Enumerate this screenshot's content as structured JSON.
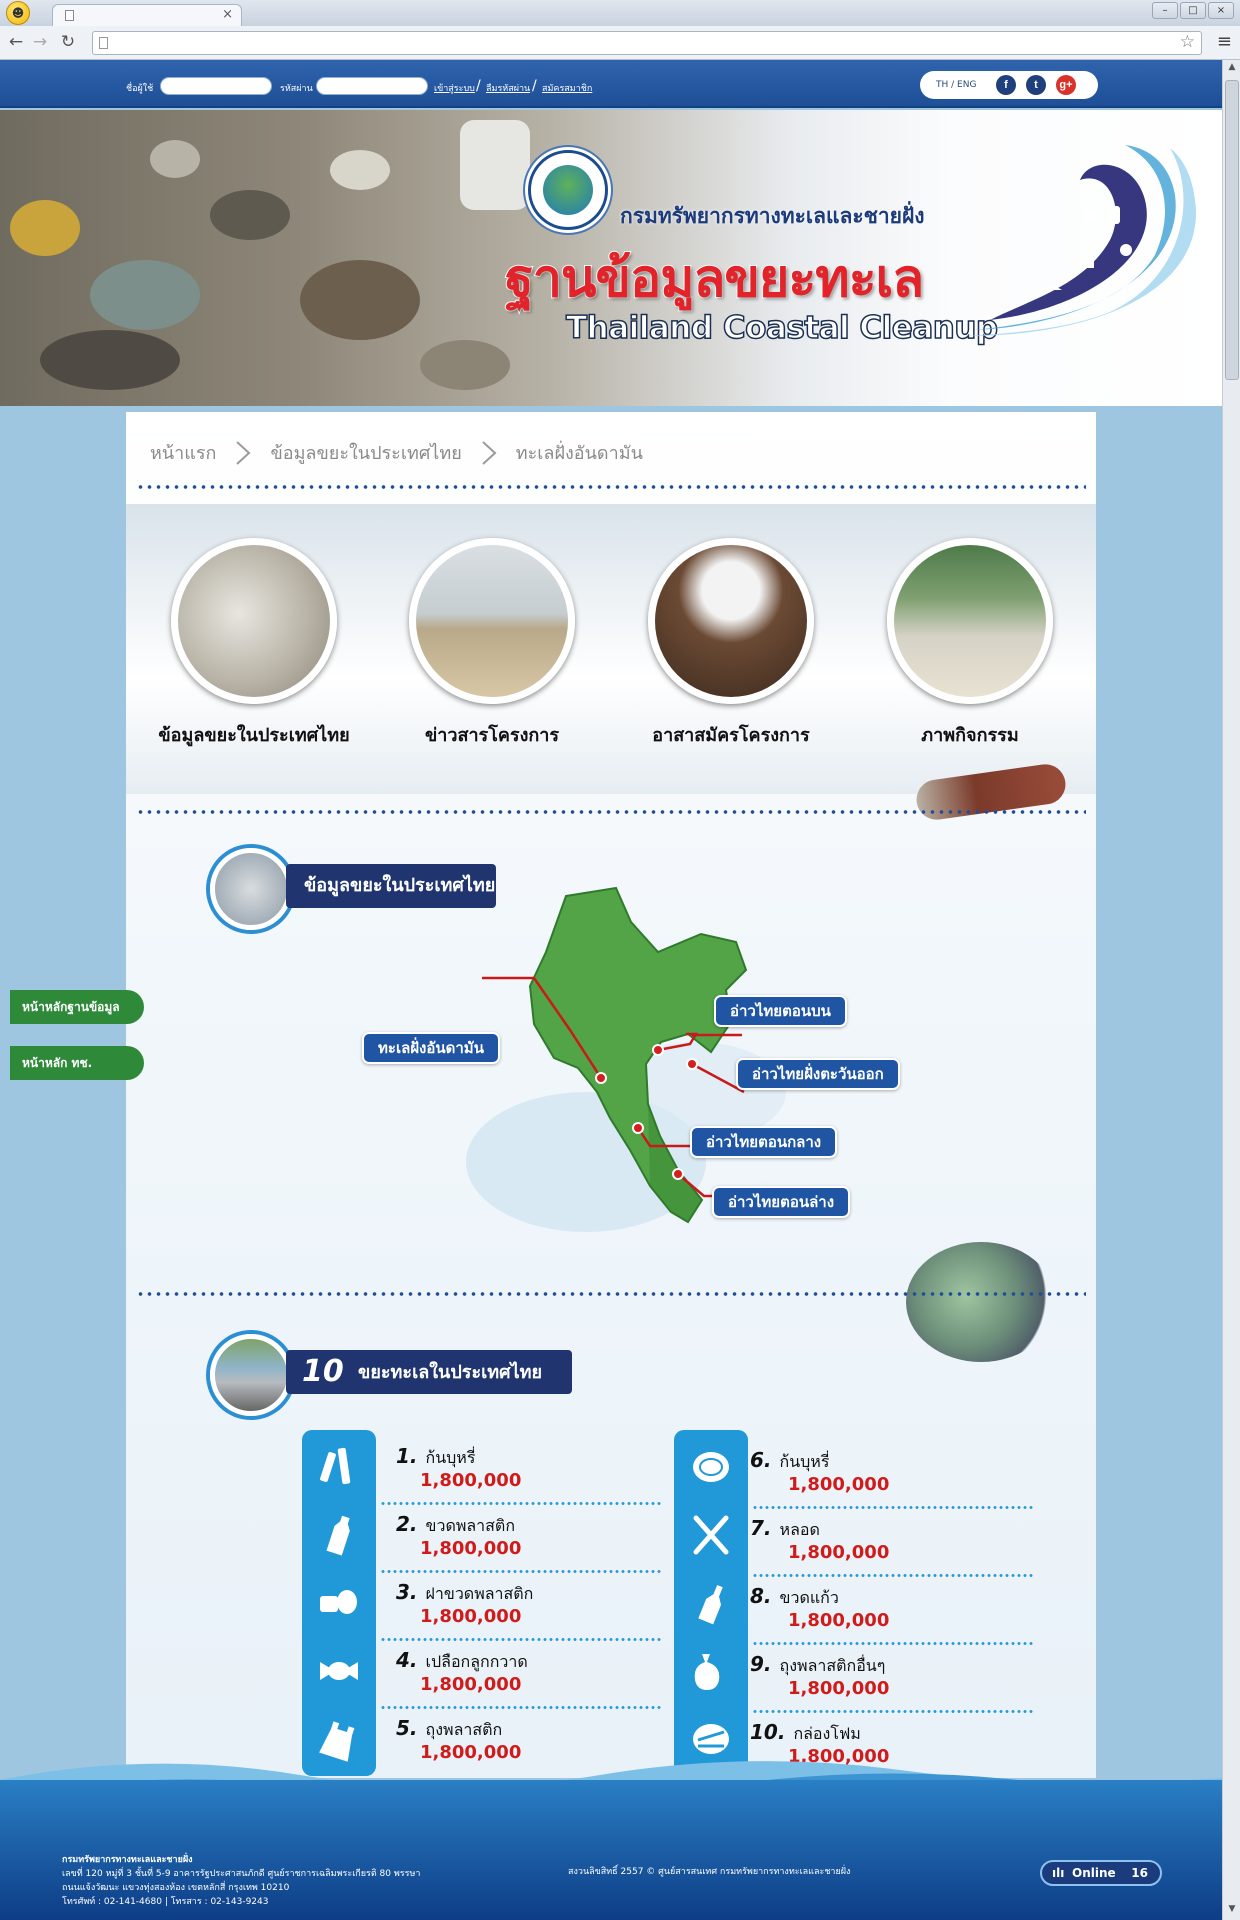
{
  "browser": {
    "tab_title": "",
    "url": "",
    "window_controls": [
      "–",
      "□",
      "×"
    ]
  },
  "topbar": {
    "username_label": "ชื่อผู้ใช้",
    "password_label": "รหัสผ่าน",
    "login_link": "เข้าสู่ระบบ",
    "forgot_link": "ลืมรหัสผ่าน",
    "register_link": "สมัครสมาชิก",
    "lang": "TH / ENG",
    "social_icons": [
      "facebook-icon",
      "twitter-icon",
      "google-plus-icon"
    ]
  },
  "banner": {
    "agency": "กรมทรัพยากรทางทะเลและชายฝั่ง",
    "title_th": "ฐานข้อมูลขยะทะเล",
    "title_en": "Thailand Coastal Cleanup"
  },
  "breadcrumb": [
    "หน้าแรก",
    "ข้อมูลขยะในประเทศไทย",
    "ทะเลฝั่งอันดามัน"
  ],
  "features": [
    {
      "label": "ข้อมูลขยะในประเทศไทย"
    },
    {
      "label": "ข่าวสารโครงการ"
    },
    {
      "label": "อาสาสมัครโครงการ"
    },
    {
      "label": "ภาพกิจกรรม"
    }
  ],
  "side_tabs": [
    "หน้าหลักฐานข้อมูล",
    "หน้าหลัก ทช."
  ],
  "map_section": {
    "heading": "ข้อมูลขยะในประเทศไทย",
    "regions": [
      "ทะเลฝั่งอันดามัน",
      "อ่าวไทยตอนบน",
      "อ่าวไทยฝั่งตะวันออก",
      "อ่าวไทยตอนกลาง",
      "อ่าวไทยตอนล่าง"
    ]
  },
  "top10": {
    "heading_num": "10",
    "heading_text": "ขยะทะเลในประเทศไทย",
    "items": [
      {
        "rank": "1.",
        "name": "ก้นบุหรี่",
        "value": "1,800,000",
        "icon": "cigarette-butts-icon"
      },
      {
        "rank": "2.",
        "name": "ขวดพลาสติก",
        "value": "1,800,000",
        "icon": "plastic-bottle-icon"
      },
      {
        "rank": "3.",
        "name": "ฝาขวดพลาสติก",
        "value": "1,800,000",
        "icon": "bottle-cap-icon"
      },
      {
        "rank": "4.",
        "name": "เปลือกลูกกวาด",
        "value": "1,800,000",
        "icon": "candy-wrapper-icon"
      },
      {
        "rank": "5.",
        "name": "ถุงพลาสติก",
        "value": "1,800,000",
        "icon": "plastic-bag-icon"
      },
      {
        "rank": "6.",
        "name": "ก้นบุหรี่",
        "value": "1,800,000",
        "icon": "plate-icon"
      },
      {
        "rank": "7.",
        "name": "หลอด",
        "value": "1,800,000",
        "icon": "straw-icon"
      },
      {
        "rank": "8.",
        "name": "ขวดแก้ว",
        "value": "1,800,000",
        "icon": "glass-bottle-icon"
      },
      {
        "rank": "9.",
        "name": "ถุงพลาสติกอื่นๆ",
        "value": "1,800,000",
        "icon": "other-bag-icon"
      },
      {
        "rank": "10.",
        "name": "กล่องโฟม",
        "value": "1,800,000",
        "icon": "foam-box-icon"
      }
    ]
  },
  "footer": {
    "org": "กรมทรัพยากรทางทะเลและชายฝั่ง",
    "address1": "เลขที่ 120 หมู่ที่ 3 ชั้นที่ 5-9 อาคารรัฐประศาสนภักดี ศูนย์ราชการเฉลิมพระเกียรติ 80 พรรษา",
    "address2": "ถนนแจ้งวัฒนะ แขวงทุ่งสองห้อง เขตหลักสี่ กรุงเทพ 10210",
    "phone": "โทรศัพท์ : 02-141-4680 | โทรสาร : 02-143-9243",
    "copyright": "สงวนลิขสิทธิ์ 2557 © ศูนย์สารสนเทศ กรมทรัพยากรทางทะเลและชายฝั่ง",
    "online_label": "Online",
    "online_count": "16"
  },
  "colors": {
    "header_blue": "#1e4f97",
    "title_red": "#e2232a",
    "navy": "#20356f",
    "pill_blue": "#1f55a3",
    "icon_bar": "#2198d8",
    "value_red": "#d01b1b",
    "side_green": "#2e8a39",
    "map_green": "#52a447"
  }
}
